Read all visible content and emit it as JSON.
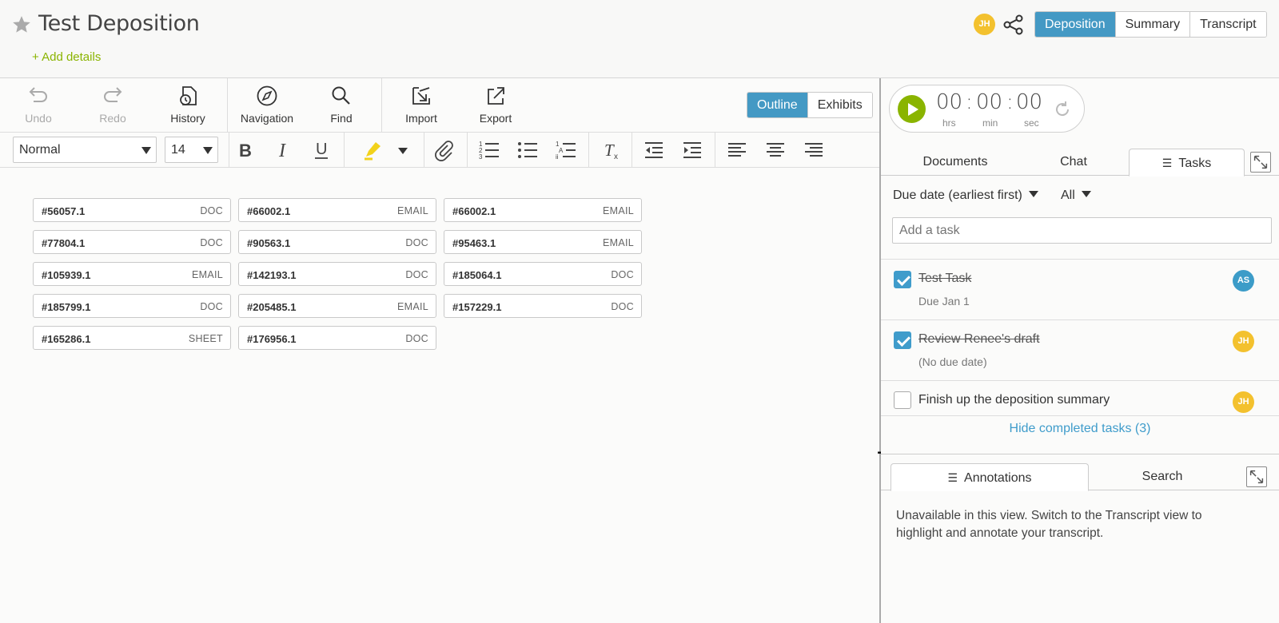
{
  "header": {
    "title": "Test Deposition",
    "add_details": "+ Add details",
    "user_initials": "JH",
    "view_tabs": [
      "Deposition",
      "Summary",
      "Transcript"
    ],
    "active_view": "Deposition"
  },
  "toolbar": {
    "undo": "Undo",
    "redo": "Redo",
    "history": "History",
    "navigation": "Navigation",
    "find": "Find",
    "import": "Import",
    "export": "Export",
    "mode_tabs": [
      "Outline",
      "Exhibits"
    ],
    "active_mode": "Outline",
    "style_value": "Normal",
    "size_value": "14"
  },
  "exhibits": [
    {
      "id": "#56057.1",
      "type": "DOC"
    },
    {
      "id": "#66002.1",
      "type": "EMAIL"
    },
    {
      "id": "#66002.1",
      "type": "EMAIL"
    },
    {
      "id": "#77804.1",
      "type": "DOC"
    },
    {
      "id": "#90563.1",
      "type": "DOC"
    },
    {
      "id": "#95463.1",
      "type": "EMAIL"
    },
    {
      "id": "#105939.1",
      "type": "EMAIL"
    },
    {
      "id": "#142193.1",
      "type": "DOC"
    },
    {
      "id": "#185064.1",
      "type": "DOC"
    },
    {
      "id": "#185799.1",
      "type": "DOC"
    },
    {
      "id": "#205485.1",
      "type": "EMAIL"
    },
    {
      "id": "#157229.1",
      "type": "DOC"
    },
    {
      "id": "#165286.1",
      "type": "SHEET"
    },
    {
      "id": "#176956.1",
      "type": "DOC"
    }
  ],
  "timer": {
    "hours": "00",
    "minutes": "00",
    "seconds": "00",
    "hours_label": "hrs",
    "minutes_label": "min",
    "seconds_label": "sec"
  },
  "panel_tabs": [
    "Documents",
    "Chat",
    "Tasks"
  ],
  "active_panel_tab": "Tasks",
  "tasks": {
    "sort": "Due date (earliest first)",
    "filter": "All",
    "add_placeholder": "Add a task",
    "items": [
      {
        "name": "Test Task",
        "due": "Due Jan 1",
        "done": true,
        "assignee": "AS"
      },
      {
        "name": "Review Renee's draft",
        "due": "(No due date)",
        "done": true,
        "assignee": "JH"
      },
      {
        "name": "Finish up the deposition summary",
        "due": "",
        "done": false,
        "assignee": "JH"
      }
    ],
    "hide_completed": "Hide completed tasks (3)"
  },
  "annotations": {
    "tabs": [
      "Annotations",
      "Search"
    ],
    "active_tab": "Annotations",
    "message": "Unavailable in this view. Switch to the Transcript view to highlight and annotate your transcript."
  },
  "colors": {
    "accent_blue": "#4499c4",
    "accent_green": "#8ab400",
    "avatar_yellow": "#f3c12e",
    "highlight_yellow": "#f2d21b"
  }
}
